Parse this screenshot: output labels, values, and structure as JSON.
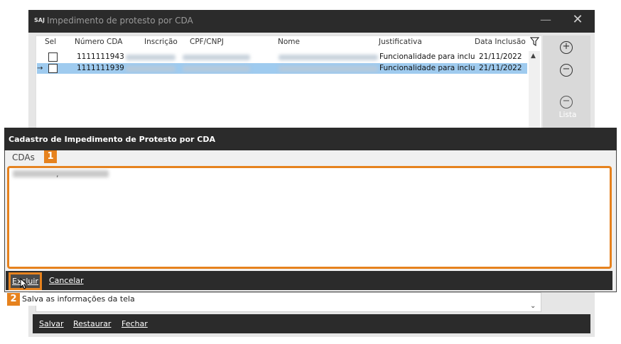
{
  "background_window": {
    "logo": "SAJ",
    "title": "Impedimento de protesto por CDA",
    "minimize_glyph": "—",
    "close_glyph": "✕",
    "grid": {
      "headers": [
        "Sel",
        "Número CDA",
        "Inscrição",
        "CPF/CNPJ",
        "Nome",
        "Justificativa",
        "Data Inclusão"
      ],
      "rows": [
        {
          "numero_cda": "1111111943",
          "justificativa": "Funcionalidade para inclu",
          "data_inclusao": "21/11/2022"
        },
        {
          "numero_cda": "1111111939",
          "justificativa": "Funcionalidade para inclu",
          "data_inclusao": "21/11/2022"
        }
      ]
    },
    "side_panel": {
      "add_icon": "plus-circle-icon",
      "remove_icon": "minus-circle-icon",
      "lista_label": "Lista"
    },
    "footer": {
      "salvar": "Salvar",
      "restaurar": "Restaurar",
      "fechar": "Fechar"
    }
  },
  "dialog": {
    "title": "Cadastro de Impedimento de Protesto por CDA",
    "cdas_label": "CDAs",
    "excluir_label": "Excluir",
    "cancelar_label": "Cancelar"
  },
  "annotations": {
    "badge1": "1",
    "badge2": "2",
    "tooltip": "Salva as informações da tela"
  },
  "colors": {
    "highlight": "#e6821e",
    "selected_row": "#9fcbef",
    "titlebar": "#2b2b2b"
  }
}
